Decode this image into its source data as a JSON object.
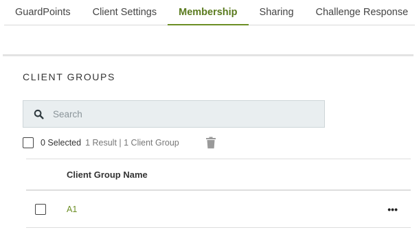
{
  "tabs": [
    {
      "label": "GuardPoints",
      "active": false
    },
    {
      "label": "Client Settings",
      "active": false
    },
    {
      "label": "Membership",
      "active": true
    },
    {
      "label": "Sharing",
      "active": false
    },
    {
      "label": "Challenge Response",
      "active": false
    }
  ],
  "section": {
    "title": "CLIENT GROUPS"
  },
  "search": {
    "placeholder": "Search",
    "value": ""
  },
  "selection": {
    "selected_label": "0 Selected",
    "result_label": "1 Result | 1 Client Group"
  },
  "table": {
    "column_header": "Client Group Name",
    "rows": [
      {
        "name": "A1",
        "menu": "•••"
      }
    ]
  },
  "colors": {
    "accent": "#6b8e23",
    "search_bg": "#e9eef0"
  }
}
